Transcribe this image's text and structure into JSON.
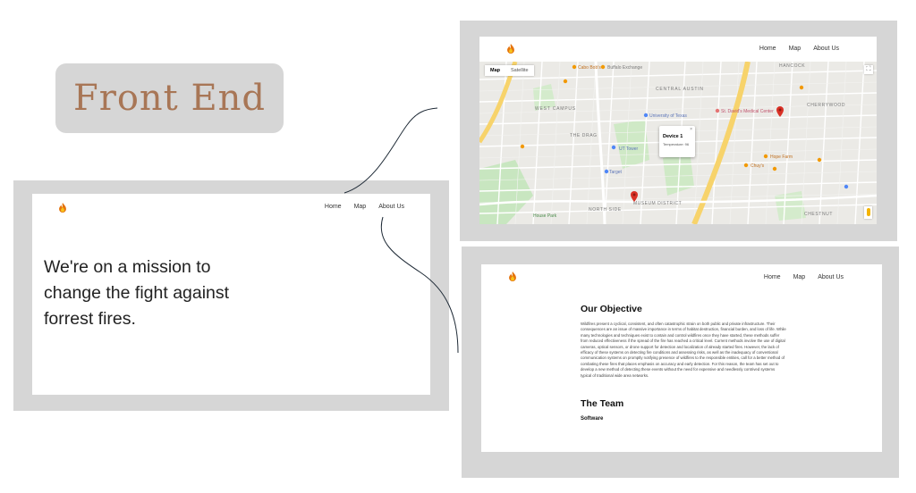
{
  "badge": {
    "label": "Front End"
  },
  "nav": {
    "home": "Home",
    "map": "Map",
    "about": "About Us"
  },
  "home_screen": {
    "hero_lines": [
      "We're on a mission to",
      "change the fight against",
      "forrest fires."
    ]
  },
  "map_screen": {
    "toggle_map": "Map",
    "toggle_satellite": "Satellite",
    "popup_title": "Device 1",
    "popup_text": "Temperature: 96",
    "place_labels": [
      "Buffalo Exchange",
      "CENTRAL AUSTIN",
      "HANCOCK",
      "WEST CAMPUS",
      "University of Texas",
      "St. David's Medical Center",
      "CHERRYWOOD",
      "THE DRAG",
      "UT Tower",
      "Target",
      "NORTH SIDE",
      "MUSEUM DISTRICT",
      "CHESTNUT",
      "House Park",
      "Cabo Bob's",
      "Chuy's",
      "Hope Farm"
    ]
  },
  "about_screen": {
    "objective_title": "Our Objective",
    "objective_text": "Wildfires present a cyclical, consistent, and often catastrophic strain on both public and private infrastructure. Their consequences are an issue of massive importance in terms of habitat destruction, financial burden, and loss of life. While many technologies and techniques exist to contain and control wildfires once they have started, these methods suffer from reduced effectiveness if the spread of the fire has reached a critical level. Current methods involve the use of digital cameras, optical sensors, or drone support for detection and localization of already started fires. However, the lack of efficacy of these systems on detecting fire conditions and assessing risks, as well as the inadequacy of conventional communication systems on promptly notifying presence of wildfires to the responsible entities, call for a better method of combating these fires that places emphasis on accuracy and early detection. For this reason, the team has set out to develop a new method of detecting these events without the need for expensive and needlessly contrived systems typical of traditional wide area networks.",
    "team_title": "The Team",
    "team_sub": "Software"
  },
  "colors": {
    "badge_text": "#a87656",
    "frame": "#d6d6d6",
    "flame_outer": "#e5740e",
    "flame_inner": "#f7c21b",
    "map_pin": "#d93025"
  },
  "icons": {
    "logo": "flame-icon",
    "map_pin": "map-pin-icon",
    "fullscreen": "fullscreen-icon",
    "pegman": "pegman-icon"
  }
}
